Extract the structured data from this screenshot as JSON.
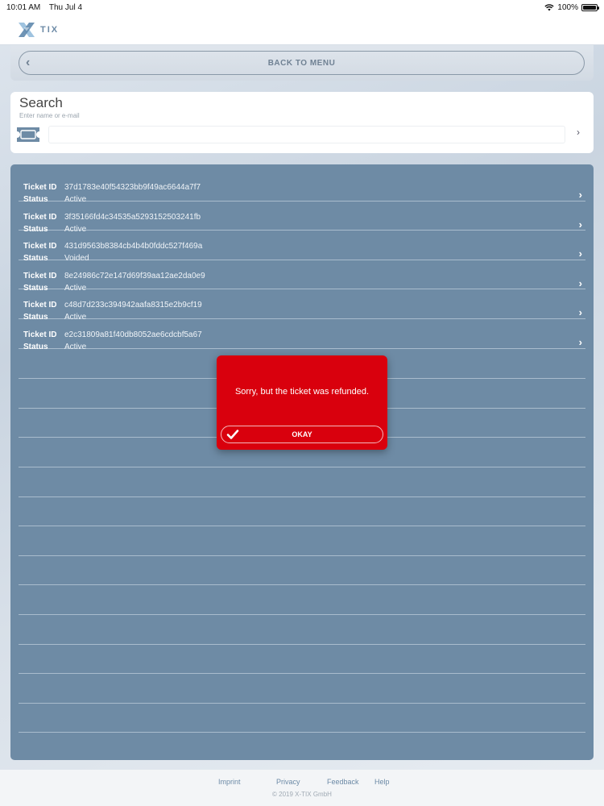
{
  "status_bar": {
    "time": "10:01 AM",
    "date": "Thu Jul 4",
    "battery": "100%"
  },
  "header": {
    "logo_text": "TIX"
  },
  "back": {
    "label": "BACK TO MENU"
  },
  "search": {
    "title": "Search",
    "placeholder": "Enter name or e-mail",
    "value": ""
  },
  "tickets": {
    "id_label": "Ticket ID",
    "status_label": "Status",
    "items": [
      {
        "id": "37d1783e40f54323bb9f49ac6644a7f7",
        "status": "Active"
      },
      {
        "id": "3f35166fd4c34535a5293152503241fb",
        "status": "Active"
      },
      {
        "id": "431d9563b8384cb4b4b0fddc527f469a",
        "status": "Voided"
      },
      {
        "id": "8e24986c72e147d69f39aa12ae2da0e9",
        "status": "Active"
      },
      {
        "id": "c48d7d233c394942aafa8315e2b9cf19",
        "status": "Active"
      },
      {
        "id": "e2c31809a81f40db8052ae6cdcbf5a67",
        "status": "Active"
      }
    ]
  },
  "alert": {
    "message": "Sorry, but the ticket was refunded.",
    "button_label": "OKAY"
  },
  "footer": {
    "links": [
      "Imprint",
      "Privacy",
      "Feedback",
      "Help"
    ],
    "copyright": "© 2019 X-TIX GmbH"
  },
  "colors": {
    "accent": "#6c8aa6",
    "panel": "#6e8ba5",
    "alert": "#d9000d"
  }
}
